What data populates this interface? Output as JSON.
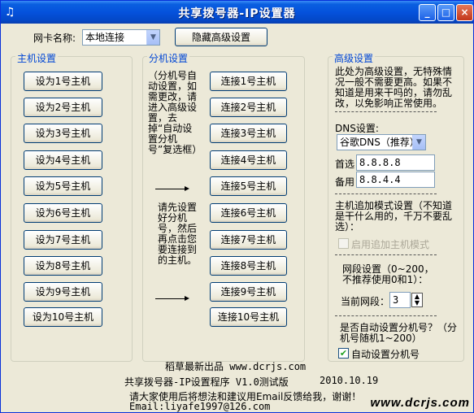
{
  "window": {
    "title": "共享拨号器-IP设置器",
    "app_icon": "music-note-icon",
    "minimize_glyph": "_",
    "maximize_glyph": "□",
    "close_glyph": "×"
  },
  "top": {
    "nic_label": "网卡名称:",
    "nic_value": "本地连接",
    "hide_advanced_button": "隐藏高级设置"
  },
  "host_group": {
    "legend": "主机设置",
    "buttons": [
      "设为1号主机",
      "设为2号主机",
      "设为3号主机",
      "设为4号主机",
      "设为5号主机",
      "设为6号主机",
      "设为7号主机",
      "设为8号主机",
      "设为9号主机",
      "设为10号主机"
    ]
  },
  "slave_group": {
    "legend": "分机设置",
    "note1": "（分机号自动设置，如需更改，请进入高级设置，去掉“自动设置分机号”复选框）",
    "note2": "请先设置好分机号，然后再点击您要连接到的主机。",
    "buttons": [
      "连接1号主机",
      "连接2号主机",
      "连接3号主机",
      "连接4号主机",
      "连接5号主机",
      "连接6号主机",
      "连接7号主机",
      "连接8号主机",
      "连接9号主机",
      "连接10号主机"
    ]
  },
  "advanced_group": {
    "legend": "高级设置",
    "intro": "此处为高级设置，无特殊情况一般不需要更高。如果不知道是用来干吗的，请勿乱改，以免影响正常使用。",
    "dns_label": "DNS设置:",
    "dns_value": "谷歌DNS（推荐）",
    "primary_label": "首选",
    "primary_value": "8.8.8.8",
    "secondary_label": "备用",
    "secondary_value": "8.8.4.4",
    "append_intro": "主机追加模式设置（不知道是干什么用的，千万不要乱选）：",
    "append_checkbox": "启用追加主机模式",
    "append_checked": false,
    "segment_intro": "网段设置（0~200，不推荐使用0和1）：",
    "segment_label": "当前网段：",
    "segment_value": "3",
    "auto_intro": "是否自动设置分机号？（分机号随机1~200）",
    "auto_checkbox": "自动设置分机号",
    "auto_checked": true
  },
  "footer": {
    "line1": "稻草最新出品 www.dcrjs.com",
    "line2_left": "共享拨号器-IP设置程序 V1.0测试版",
    "line2_right": "2010.10.19",
    "line3": "请大家使用后将想法和建议用Email反馈给我，谢谢！",
    "line4": "Email:liyafe1997@126.com",
    "watermark": "www.dcrjs.com"
  }
}
